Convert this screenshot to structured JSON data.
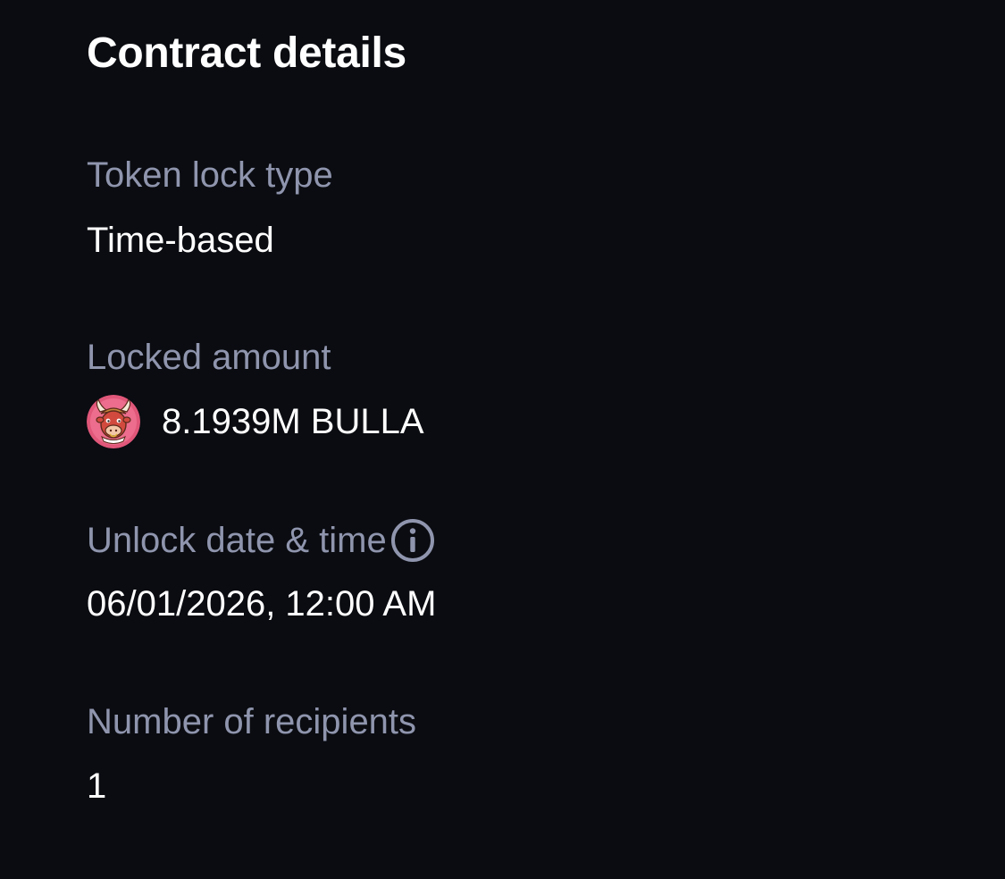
{
  "section": {
    "title": "Contract details"
  },
  "fields": {
    "lock_type": {
      "label": "Token lock type",
      "value": "Time-based"
    },
    "locked_amount": {
      "label": "Locked amount",
      "value": "8.1939M BULLA",
      "token_icon": "bull-mascot-token-icon"
    },
    "unlock": {
      "label": "Unlock date & time",
      "value": "06/01/2026, 12:00 AM",
      "info_icon": "info-icon"
    },
    "recipients": {
      "label": "Number of recipients",
      "value": "1"
    }
  },
  "colors": {
    "background": "#0a0c11",
    "label": "#8f95ad",
    "value": "#ffffff",
    "token_badge": "#e0577a"
  }
}
